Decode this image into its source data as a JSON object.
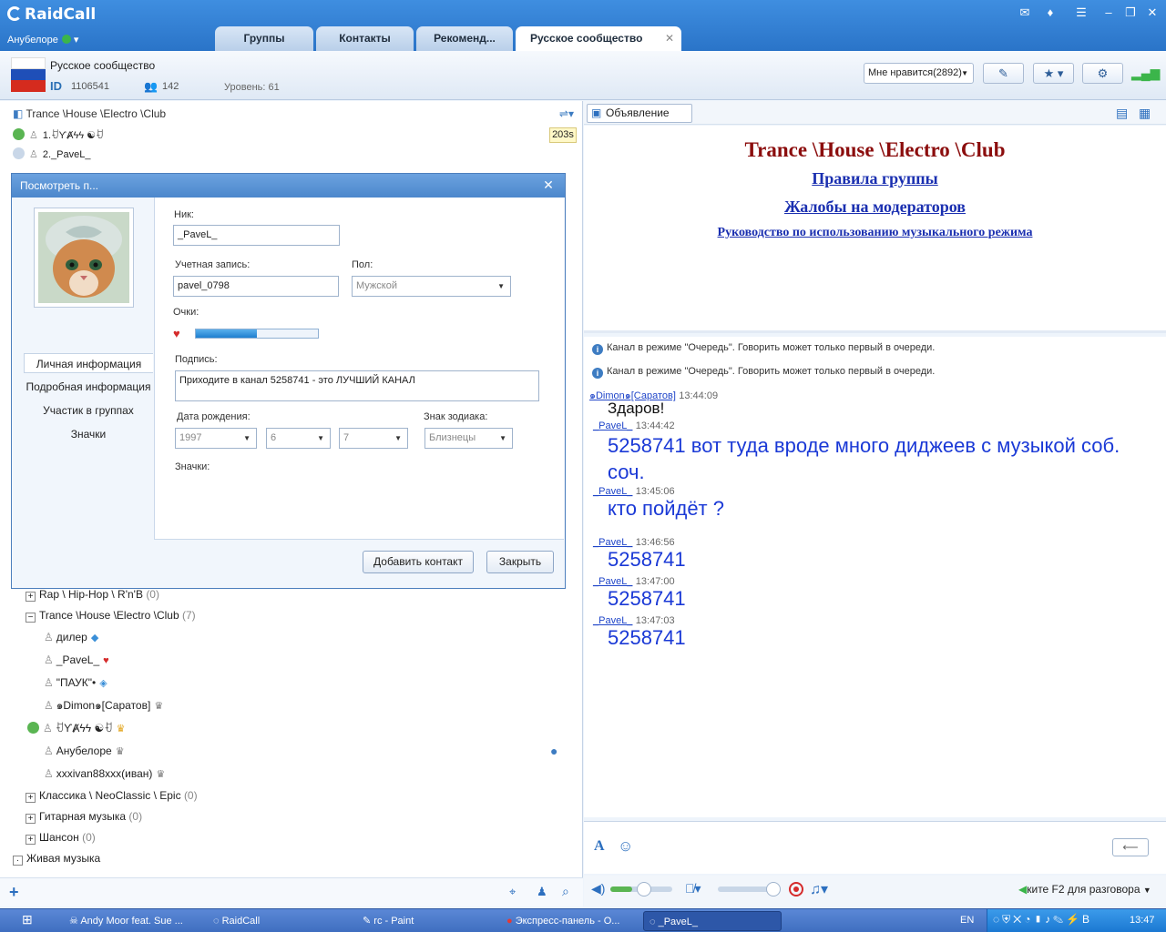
{
  "app": {
    "name": "RaidCall",
    "user": "Анубелоре"
  },
  "tabs": [
    {
      "label": "Группы"
    },
    {
      "label": "Контакты"
    },
    {
      "label": "Рекоменд..."
    },
    {
      "label": "Русское сообщество"
    }
  ],
  "channel": {
    "name": "Русское сообщество",
    "id_label": "ID",
    "id": "1106541",
    "members": "142",
    "level": "Уровень: 61",
    "like": "Мне нравится(2892)",
    "breadcrumb": "Trance \\House \\Electro \\Club"
  },
  "queue": [
    {
      "name": "1.ꀀƳȺϟϟ ☯ꀀ"
    },
    {
      "name": "2._PaveL_"
    }
  ],
  "queue_timer": "203s",
  "dialog": {
    "title": "Посмотреть п...",
    "nav": [
      "Личная информация",
      "Подробная информация",
      "Участик в группах",
      "Значки"
    ],
    "nick_label": "Ник:",
    "nick": "_PaveL_",
    "account_label": "Учетная запись:",
    "account": "pavel_0798",
    "gender_label": "Пол:",
    "gender": "Мужской",
    "points_label": "Очки:",
    "points_progress": 0.5,
    "signature_label": "Подпись:",
    "signature": "Приходите в канал 5258741 - это ЛУЧШИЙ КАНАЛ",
    "birth_label": "Дата рождения:",
    "birth_year": "1997",
    "birth_month": "6",
    "birth_day": "7",
    "zodiac_label": "Знак зодиака:",
    "zodiac": "Близнецы",
    "badges_label": "Значки:",
    "add_button": "Добавить контакт",
    "close_button": "Закрыть"
  },
  "tree": {
    "rap": {
      "name": "Rap \\ Hip-Hop \\ R'n'B",
      "count": "(0)"
    },
    "trance": {
      "name": "Trance \\House \\Electro \\Club",
      "count": "(7)"
    },
    "users": [
      {
        "name": "дилер"
      },
      {
        "name": "_PaveL_"
      },
      {
        "name": "\"ПАУК\"•"
      },
      {
        "name": "๑Dimon๑[Саратов]"
      },
      {
        "name": "ꀀƳȺϟϟ ☯ꀀ"
      },
      {
        "name": "Анубелоре"
      },
      {
        "name": "xxxivan88xxx(иван)"
      }
    ],
    "classic": {
      "name": "Классика \\ NeoClassic \\ Epic",
      "count": "(0)"
    },
    "guitar": {
      "name": "Гитарная музыка",
      "count": "(0)"
    },
    "chanson": {
      "name": "Шансон",
      "count": "(0)"
    },
    "live": {
      "name": "Живая музыка"
    }
  },
  "announcement": {
    "button": "Объявление",
    "title": "Trance \\House \\Electro \\Club",
    "link1": "Правила группы",
    "link2": "Жалобы на модераторов",
    "link3": "Руководство по использованию музыкального режима"
  },
  "chat": {
    "sys1": "Канал в режиме \"Очередь\". Говорить может только первый в очереди.",
    "sys2": "Канал в режиме \"Очередь\". Говорить может только первый в очереди.",
    "messages": [
      {
        "nick": "๑Dimon๑[Саратов]",
        "time": "13:44:09",
        "text": "Здаров!"
      },
      {
        "nick": "_PaveL_",
        "time": "13:44:42",
        "text": "5258741 вот туда вроде много диджеев с музыкой соб. соч."
      },
      {
        "nick": "_PaveL_",
        "time": "13:45:06",
        "text": "кто пойдёт ?"
      },
      {
        "nick": "_PaveL_",
        "time": "13:46:56",
        "text": "5258741"
      },
      {
        "nick": "_PaveL_",
        "time": "13:47:00",
        "text": "5258741"
      },
      {
        "nick": "_PaveL_",
        "time": "13:47:03",
        "text": "5258741"
      }
    ]
  },
  "bottom": {
    "f2_hint": "ките F2 для разговора"
  },
  "taskbar": {
    "items": [
      "Andy Moor feat. Sue ...",
      "RaidCall",
      "rc - Paint",
      "Экспресс-панель - О...",
      "_PaveL_"
    ],
    "lang": "EN",
    "clock": "13:47"
  },
  "colors": {
    "accent": "#2a74c8",
    "announce_title": "#8b0d0d",
    "chat_text": "#1a39d6"
  }
}
